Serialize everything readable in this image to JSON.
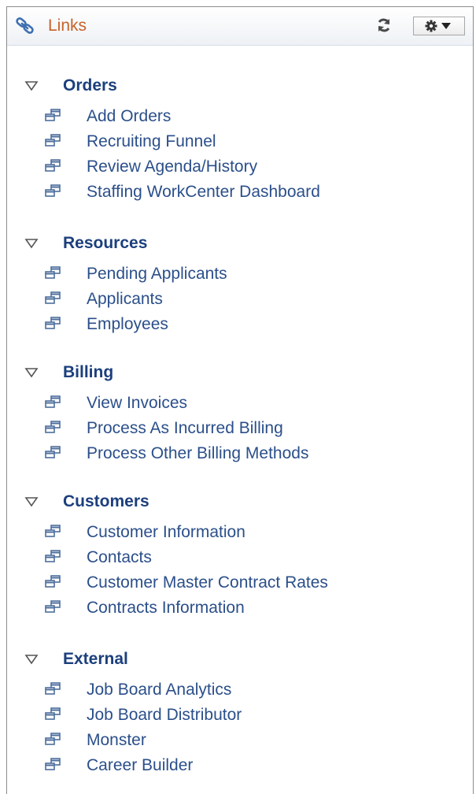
{
  "header": {
    "title": "Links",
    "title_icon": "links-chain-icon",
    "refresh_icon": "refresh-icon",
    "actions_icon": "gear-icon"
  },
  "sections": [
    {
      "label": "Orders",
      "links": [
        "Add Orders",
        "Recruiting Funnel",
        "Review Agenda/History",
        "Staffing WorkCenter Dashboard"
      ]
    },
    {
      "label": "Resources",
      "links": [
        "Pending Applicants",
        "Applicants",
        "Employees"
      ]
    },
    {
      "label": "Billing",
      "links": [
        "View Invoices",
        "Process As Incurred Billing",
        "Process Other Billing Methods"
      ]
    },
    {
      "label": "Customers",
      "links": [
        "Customer Information",
        "Contacts",
        "Customer Master Contract Rates",
        "Contracts Information"
      ]
    },
    {
      "label": "External",
      "links": [
        "Job Board Analytics",
        "Job Board Distributor",
        "Monster",
        "Career Builder"
      ]
    }
  ],
  "colors": {
    "title": "#c8622a",
    "section_label": "#1c3f7d",
    "link_text": "#2b4f8a",
    "border": "#8c8c8c"
  }
}
